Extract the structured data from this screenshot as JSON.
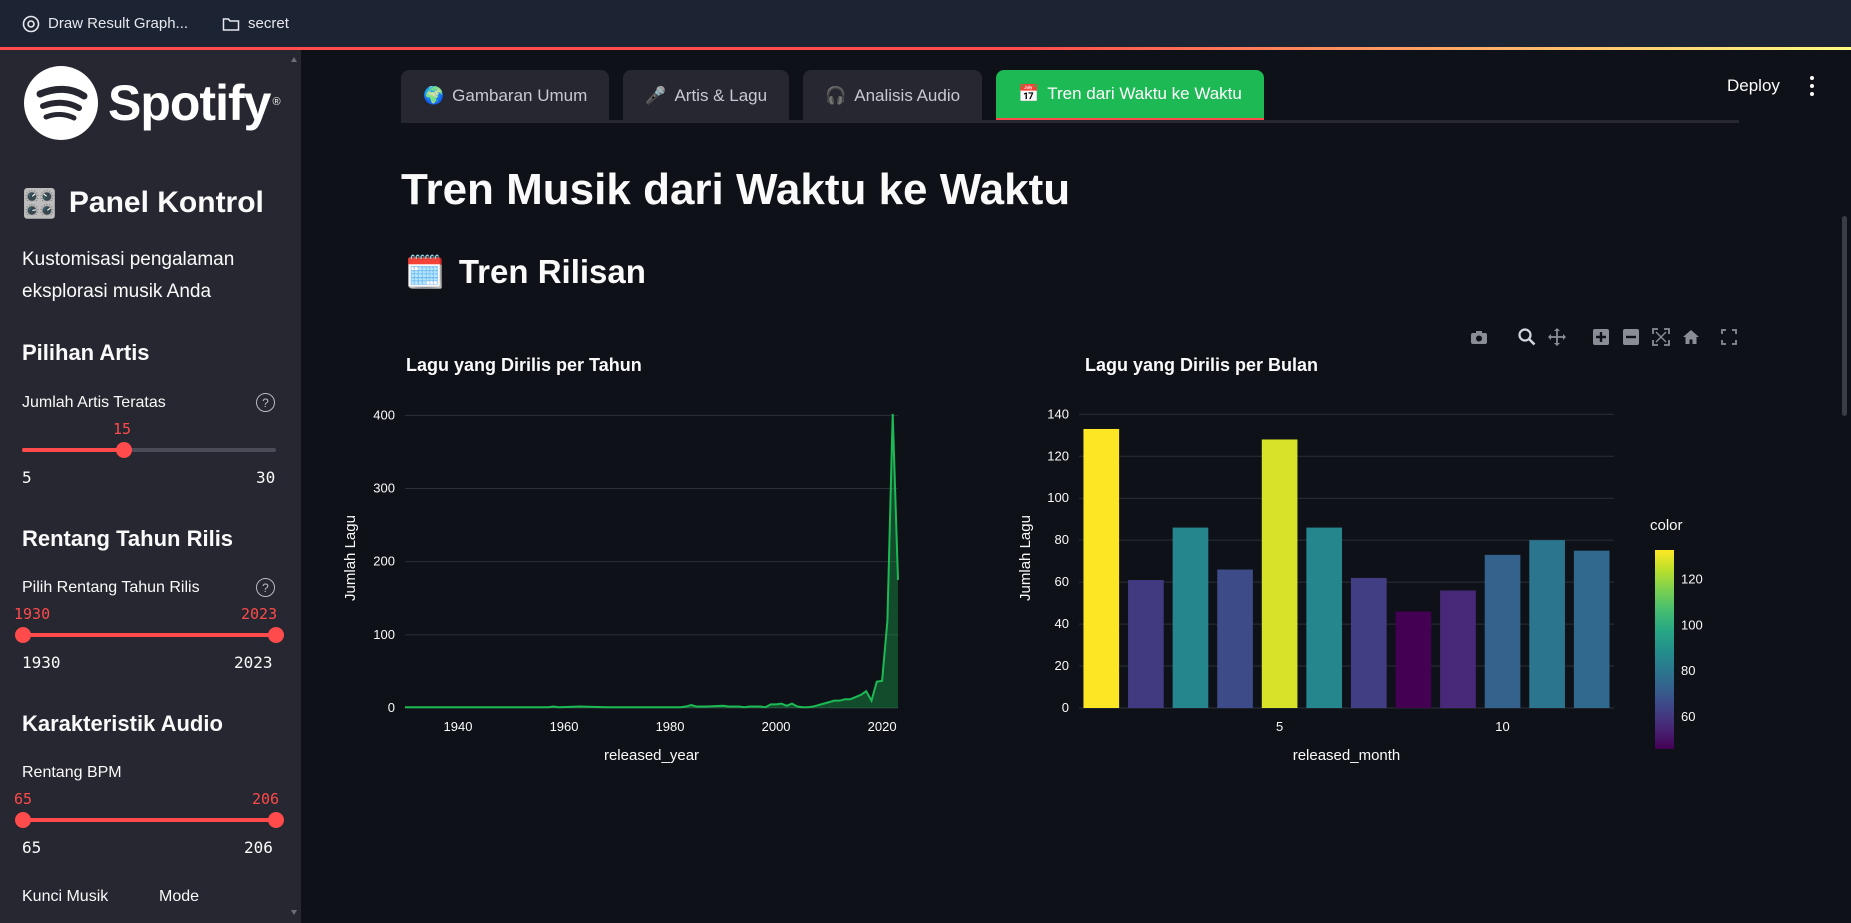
{
  "browser": {
    "tabs": [
      {
        "label": "Draw Result Graph...",
        "icon": "chatgpt-icon"
      },
      {
        "label": "secret",
        "icon": "folder-icon"
      }
    ]
  },
  "sidebar": {
    "logo_text": "Spotify",
    "logo_reg": "®",
    "panel_title": "Panel Kontrol",
    "panel_icon": "🎛️",
    "description": "Kustomisasi pengalaman eksplorasi musik Anda",
    "artist_section": "Pilihan Artis",
    "top_artists": {
      "label": "Jumlah Artis Teratas",
      "value": "15",
      "min": "5",
      "max": "30",
      "fraction": 0.4
    },
    "year_section": "Rentang Tahun Rilis",
    "year_range": {
      "label": "Pilih Rentang Tahun Rilis",
      "low": "1930",
      "high": "2023",
      "min": "1930",
      "max": "2023"
    },
    "audio_section": "Karakteristik Audio",
    "bpm_range": {
      "label": "Rentang BPM",
      "low": "65",
      "high": "206",
      "min": "65",
      "max": "206"
    },
    "key_label": "Kunci Musik",
    "mode_label": "Mode"
  },
  "header": {
    "deploy_label": "Deploy",
    "tabs": [
      {
        "icon": "🌍",
        "label": "Gambaran Umum"
      },
      {
        "icon": "🎤",
        "label": "Artis & Lagu"
      },
      {
        "icon": "🎧",
        "label": "Analisis Audio"
      },
      {
        "icon": "📅",
        "label": "Tren dari Waktu ke Waktu",
        "active": true
      }
    ]
  },
  "main": {
    "title": "Tren Musik dari Waktu ke Waktu",
    "section_icon": "🗓️",
    "section_title": "Tren Rilisan"
  },
  "colors": {
    "accent": "#ff4b4b",
    "spotify_green": "#1db954",
    "background": "#0e1117",
    "sidebar": "#262730"
  },
  "modebar_icons": [
    "camera-icon",
    "zoom-icon",
    "pan-icon",
    "zoom-in-icon",
    "zoom-out-icon",
    "autoscale-icon",
    "reset-axes-icon",
    "fullscreen-icon"
  ],
  "chart_data": [
    {
      "type": "area",
      "title": "Lagu yang Dirilis per Tahun",
      "xlabel": "released_year",
      "ylabel": "Jumlah Lagu",
      "xlim": [
        1930,
        2023
      ],
      "ylim": [
        0,
        410
      ],
      "xticks": [
        "1940",
        "1960",
        "1980",
        "2000",
        "2020"
      ],
      "yticks": [
        "0",
        "100",
        "200",
        "300",
        "400"
      ],
      "color": "#1db954",
      "x": [
        1930,
        1942,
        1946,
        1950,
        1952,
        1955,
        1957,
        1958,
        1959,
        1963,
        1968,
        1970,
        1971,
        1973,
        1975,
        1979,
        1982,
        1983,
        1984,
        1985,
        1986,
        1987,
        1990,
        1991,
        1992,
        1993,
        1994,
        1995,
        1996,
        1997,
        1998,
        1999,
        2000,
        2001,
        2002,
        2003,
        2004,
        2005,
        2006,
        2007,
        2008,
        2009,
        2010,
        2011,
        2012,
        2013,
        2014,
        2015,
        2016,
        2017,
        2018,
        2019,
        2020,
        2021,
        2022,
        2023
      ],
      "y": [
        1,
        1,
        1,
        1,
        1,
        1,
        1,
        2,
        1,
        2,
        1,
        1,
        1,
        1,
        1,
        1,
        1,
        2,
        4,
        2,
        2,
        2,
        3,
        2,
        2,
        2,
        1,
        2,
        2,
        2,
        1,
        5,
        5,
        6,
        3,
        6,
        2,
        1,
        1,
        2,
        4,
        6,
        8,
        10,
        10,
        12,
        12,
        15,
        18,
        23,
        10,
        36,
        37,
        119,
        402,
        175
      ]
    },
    {
      "type": "bar",
      "title": "Lagu yang Dirilis per Bulan",
      "xlabel": "released_month",
      "ylabel": "Jumlah Lagu",
      "categories": [
        1,
        2,
        3,
        4,
        5,
        6,
        7,
        8,
        9,
        10,
        11,
        12
      ],
      "values": [
        133,
        61,
        86,
        66,
        128,
        86,
        62,
        46,
        56,
        73,
        80,
        75
      ],
      "ylim": [
        0,
        143
      ],
      "xticks": [
        "5",
        "10"
      ],
      "yticks": [
        "0",
        "20",
        "40",
        "60",
        "80",
        "100",
        "120",
        "140"
      ],
      "colorbar": {
        "title": "color",
        "ticks": [
          "60",
          "80",
          "100",
          "120"
        ],
        "range": [
          46,
          133
        ],
        "colorscale": "viridis"
      }
    }
  ]
}
